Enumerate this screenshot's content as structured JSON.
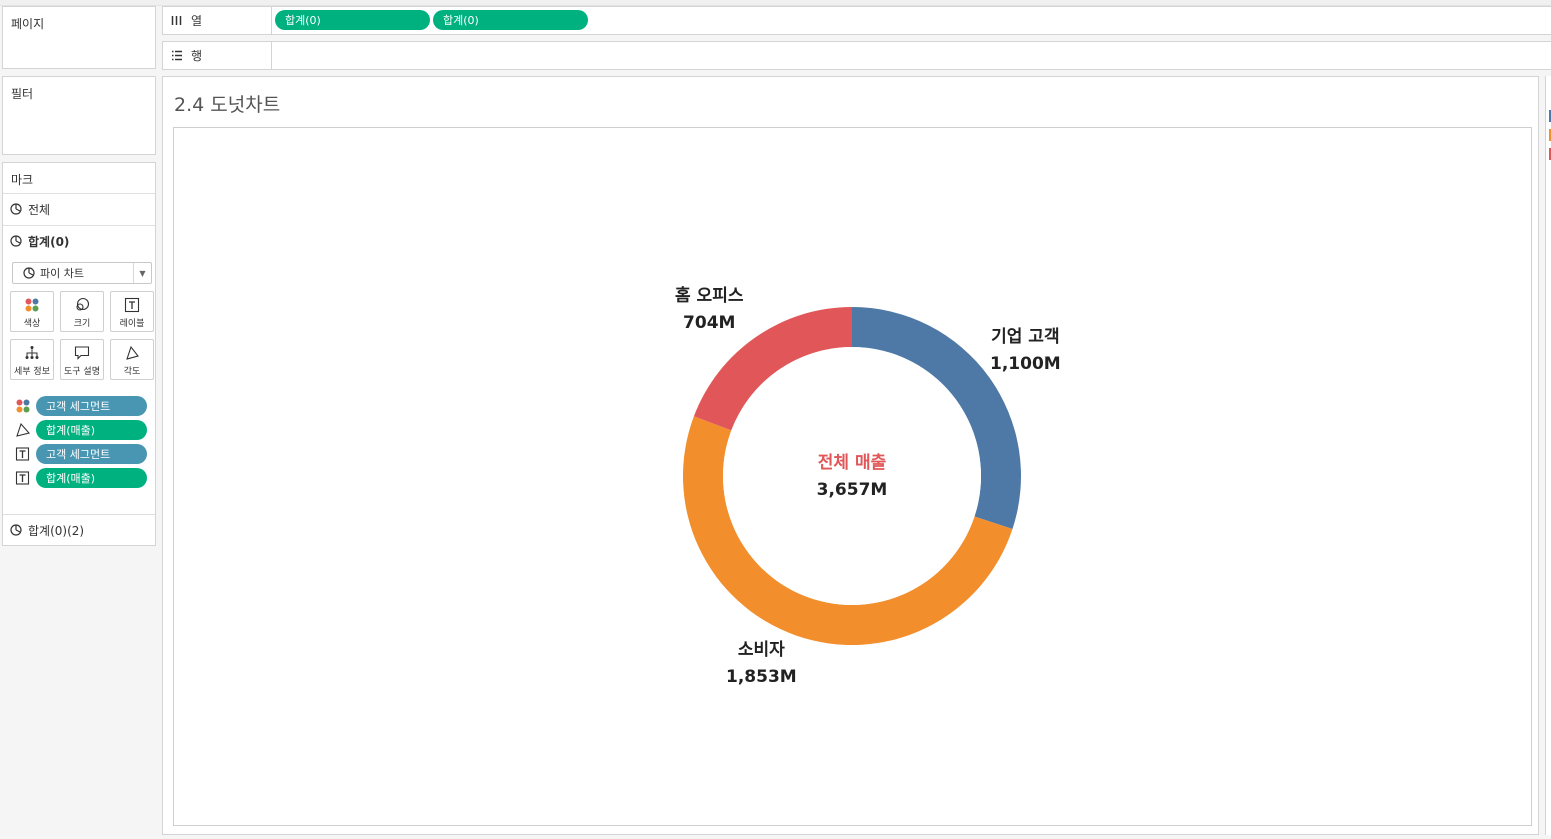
{
  "panels": {
    "pages_title": "페이지",
    "filters_title": "필터",
    "marks_title": "마크"
  },
  "shelves": {
    "columns": {
      "label": "열",
      "pills": [
        "합계(0)",
        "합계(0)"
      ]
    },
    "rows": {
      "label": "행"
    }
  },
  "marks": {
    "all_label": "전체",
    "sum0_label": "합계(0)",
    "mark_type": "파이 차트",
    "tiles": [
      "색상",
      "크기",
      "레이블",
      "세부 정보",
      "도구 설명",
      "각도"
    ],
    "encodings": [
      {
        "icon": "color-icon",
        "field": "고객 세그먼트",
        "kind": "dimension"
      },
      {
        "icon": "angle-icon",
        "field": "합계(매출)",
        "kind": "measure"
      },
      {
        "icon": "label-icon",
        "field": "고객 세그먼트",
        "kind": "dimension"
      },
      {
        "icon": "label-icon",
        "field": "합계(매출)",
        "kind": "measure"
      }
    ],
    "sum02_label": "합계(0)(2)"
  },
  "view": {
    "title": "2.4 도넛차트",
    "center_title": "전체 매출",
    "center_value": "3,657M",
    "center_color": "#e15759"
  },
  "chart_data": {
    "type": "pie",
    "title": "2.4 도넛차트",
    "categories": [
      "기업 고객",
      "소비자",
      "홈 오피스"
    ],
    "values": [
      1100,
      1853,
      704
    ],
    "value_labels": [
      "1,100M",
      "1,853M",
      "704M"
    ],
    "colors": [
      "#4e79a7",
      "#f28e2b",
      "#e15759"
    ],
    "total": 3657,
    "donut": true
  }
}
